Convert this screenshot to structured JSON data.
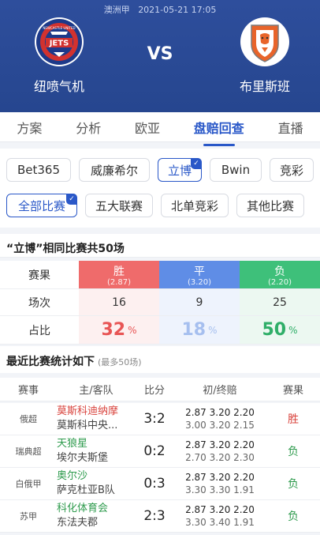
{
  "header": {
    "league": "澳洲甲",
    "datetime": "2021-05-21 17:05",
    "home_team": "纽喷气机",
    "away_team": "布里斯班",
    "vs": "VS",
    "home_logo_text": "NEWCASTLE UNITED",
    "home_logo_word": "JETS",
    "colors": {
      "background": "#2b4a96",
      "home_logo_red": "#d2322f",
      "home_logo_blue": "#1d3a8a",
      "away_logo_orange": "#e8642a"
    }
  },
  "tabs": [
    {
      "label": "方案",
      "active": false
    },
    {
      "label": "分析",
      "active": false
    },
    {
      "label": "欧亚",
      "active": false
    },
    {
      "label": "盘赔回查",
      "active": true
    },
    {
      "label": "直播",
      "active": false
    }
  ],
  "bookmakers": [
    {
      "label": "Bet365",
      "selected": false
    },
    {
      "label": "威廉希尔",
      "selected": false
    },
    {
      "label": "立博",
      "selected": true
    },
    {
      "label": "Bwin",
      "selected": false
    },
    {
      "label": "竞彩",
      "selected": false
    }
  ],
  "competition_filters": [
    {
      "label": "全部比赛",
      "selected": true
    },
    {
      "label": "五大联赛",
      "selected": false
    },
    {
      "label": "北单竞彩",
      "selected": false
    },
    {
      "label": "其他比赛",
      "selected": false
    }
  ],
  "stats": {
    "title": "“立博”相同比赛共50场",
    "row_labels": {
      "result": "赛果",
      "count": "场次",
      "ratio": "占比"
    },
    "win": {
      "label": "胜",
      "odds": "(2.87)",
      "count": "16",
      "pct": "32",
      "unit": "%"
    },
    "draw": {
      "label": "平",
      "odds": "(3.20)",
      "count": "9",
      "pct": "18",
      "unit": "%"
    },
    "lose": {
      "label": "负",
      "odds": "(2.20)",
      "count": "25",
      "pct": "50",
      "unit": "%"
    }
  },
  "recent": {
    "title": "最近比赛统计如下",
    "subtitle": "(最多50场)",
    "columns": [
      "赛事",
      "主/客队",
      "比分",
      "初/终赔",
      "赛果"
    ],
    "matches": [
      {
        "league": "俄超",
        "home": "莫斯科迪纳摩",
        "away": "莫斯科中央...",
        "score": "3:2",
        "odds_initial": "2.87 3.20 2.20",
        "odds_final": "3.00 3.20 2.15",
        "result": "胜",
        "home_color": "red"
      },
      {
        "league": "瑞典超",
        "home": "天狼星",
        "away": "埃尔夫斯堡",
        "score": "0:2",
        "odds_initial": "2.87 3.20 2.20",
        "odds_final": "2.70 3.20 2.30",
        "result": "负",
        "home_color": "green"
      },
      {
        "league": "白俄甲",
        "home": "奥尔沙",
        "away": "萨克杜亚B队",
        "score": "0:3",
        "odds_initial": "2.87 3.20 2.20",
        "odds_final": "3.30 3.30 1.91",
        "result": "负",
        "home_color": "green"
      },
      {
        "league": "苏甲",
        "home": "科化体育会",
        "away": "东法夫郡",
        "score": "2:3",
        "odds_initial": "2.87 3.20 2.20",
        "odds_final": "3.30 3.40 1.91",
        "result": "负",
        "home_color": "green"
      }
    ]
  }
}
